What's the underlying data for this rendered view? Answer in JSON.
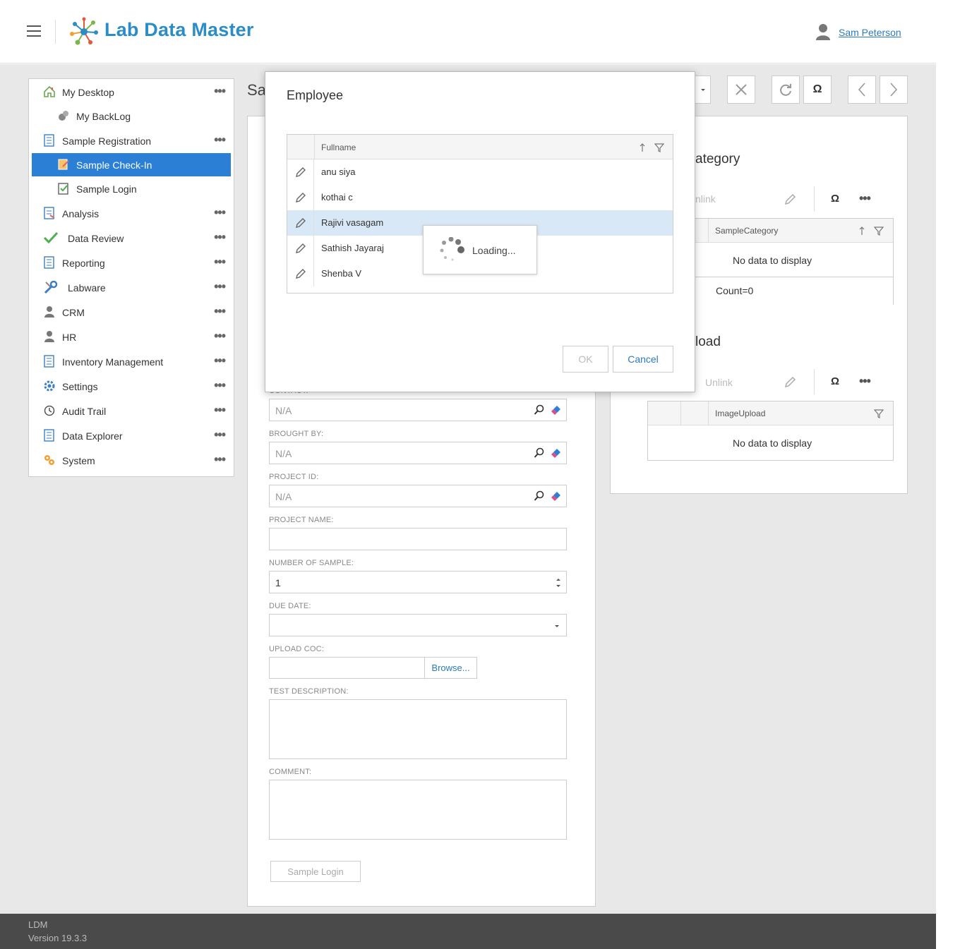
{
  "header": {
    "app_title": "Lab Data Master",
    "user_name": "Sam Peterson"
  },
  "sidebar": {
    "items": [
      {
        "label": "My Desktop",
        "icon": "home-icon",
        "more": "•••"
      },
      {
        "label": "My BackLog",
        "icon": "backlog-icon",
        "more": ""
      },
      {
        "label": "Sample Registration",
        "icon": "document-list-icon",
        "more": "•••"
      },
      {
        "label": "Sample Check-In",
        "icon": "check-in-icon",
        "more": ""
      },
      {
        "label": "Sample Login",
        "icon": "checklist-icon",
        "more": ""
      },
      {
        "label": "Analysis",
        "icon": "analysis-icon",
        "more": "•••"
      },
      {
        "label": "Data Review",
        "icon": "checkmark-icon",
        "more": "•••"
      },
      {
        "label": "Reporting",
        "icon": "document-list-icon",
        "more": "•••"
      },
      {
        "label": "Labware",
        "icon": "wrench-icon",
        "more": "•••"
      },
      {
        "label": "CRM",
        "icon": "person-icon",
        "more": "•••"
      },
      {
        "label": "HR",
        "icon": "person-icon",
        "more": "•••"
      },
      {
        "label": "Inventory Management",
        "icon": "document-list-icon",
        "more": "•••"
      },
      {
        "label": "Settings",
        "icon": "gear-icon",
        "more": "•••"
      },
      {
        "label": "Audit Trail",
        "icon": "history-icon",
        "more": "•••"
      },
      {
        "label": "Data Explorer",
        "icon": "document-list-icon",
        "more": "•••"
      },
      {
        "label": "System",
        "icon": "system-icon",
        "more": "•••"
      }
    ]
  },
  "page": {
    "title_partial": "Sa"
  },
  "form": {
    "contact_label": "CONTACT:",
    "contact_value": "N/A",
    "brought_by_label": "BROUGHT BY:",
    "brought_by_value": "N/A",
    "project_id_label": "PROJECT ID:",
    "project_id_value": "N/A",
    "project_name_label": "PROJECT NAME:",
    "project_name_value": "",
    "number_of_sample_label": "NUMBER OF SAMPLE:",
    "number_of_sample_value": "1",
    "due_date_label": "DUE DATE:",
    "due_date_value": "",
    "upload_coc_label": "UPLOAD COC:",
    "browse_label": "Browse...",
    "test_description_label": "TEST DESCRIPTION:",
    "comment_label": "COMMENT:",
    "sample_login_button": "Sample Login"
  },
  "toolbar": {
    "omega": "Ω"
  },
  "right_panel": {
    "category_title_partial": "ategory",
    "unlink_partial": "nlink",
    "samplecategory_header": "SampleCategory",
    "no_data_1": "No data to display",
    "count": "Count=0",
    "upload_title_partial": "load",
    "unlink": "Unlink",
    "imageupload_header": "ImageUpload",
    "no_data_2": "No data to display",
    "more": "•••",
    "omega": "Ω"
  },
  "dialog": {
    "title": "Employee",
    "column_header": "Fullname",
    "rows": [
      "anu siya",
      "kothai c",
      "Rajivi vasagam",
      "Sathish Jayaraj",
      "Shenba V"
    ],
    "selected_row": 2,
    "loading_text": "Loading...",
    "ok_label": "OK",
    "cancel_label": "Cancel"
  },
  "footer": {
    "line1": "LDM",
    "line2": "Version 19.3.3"
  },
  "colors": {
    "accent": "#2b80d6",
    "brand": "#2a8dc6",
    "selected_row": "#d9e8f6",
    "footer_bg": "#4a4a4a"
  }
}
